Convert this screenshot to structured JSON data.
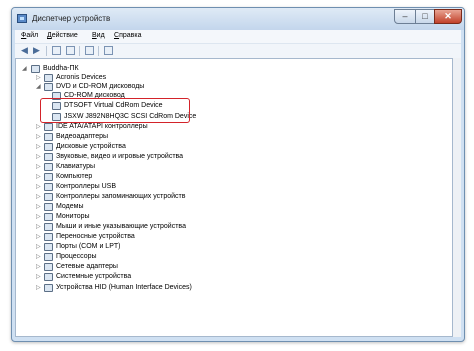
{
  "window": {
    "title": "Диспетчер устройств",
    "controls": {
      "minimize": "–",
      "maximize": "□",
      "close": "✕"
    }
  },
  "menu": [
    {
      "label": "Файл",
      "underline": "Ф",
      "rest": "айл"
    },
    {
      "label": "Действие",
      "underline": "Д",
      "rest": "ействие"
    },
    {
      "label": "Вид",
      "underline": "В",
      "rest": "ид"
    },
    {
      "label": "Справка",
      "underline": "С",
      "rest": "правка"
    }
  ],
  "toolbar": {
    "icons": [
      "back-arrow-icon",
      "forward-arrow-icon",
      "properties-icon",
      "help-icon",
      "device-list-icon",
      "scan-hardware-icon"
    ]
  },
  "tree": {
    "root": "Buddha-ПК",
    "items": [
      {
        "label": "Acronis Devices",
        "expander": "▷"
      },
      {
        "label": "DVD и CD-ROM дисководы",
        "expander": "◢",
        "children": [
          "CD-ROM дисковод",
          "DTSOFT Virtual CdRom Device",
          "JSXW J892N8HQ3C SCSI CdRom Device"
        ]
      },
      {
        "label": "IDE ATA/ATAPI контроллеры",
        "expander": "▷"
      },
      {
        "label": "Видеоадаптеры",
        "expander": "▷"
      },
      {
        "label": "Дисковые устройства",
        "expander": "▷"
      },
      {
        "label": "Звуковые, видео и игровые устройства",
        "expander": "▷"
      },
      {
        "label": "Клавиатуры",
        "expander": "▷"
      },
      {
        "label": "Компьютер",
        "expander": "▷"
      },
      {
        "label": "Контроллеры USB",
        "expander": "▷"
      },
      {
        "label": "Контроллеры запоминающих устройств",
        "expander": "▷"
      },
      {
        "label": "Модемы",
        "expander": "▷"
      },
      {
        "label": "Мониторы",
        "expander": "▷"
      },
      {
        "label": "Мыши и иные указывающие устройства",
        "expander": "▷"
      },
      {
        "label": "Переносные устройства",
        "expander": "▷"
      },
      {
        "label": "Порты (COM и LPT)",
        "expander": "▷"
      },
      {
        "label": "Процессоры",
        "expander": "▷"
      },
      {
        "label": "Сетевые адаптеры",
        "expander": "▷"
      },
      {
        "label": "Системные устройства",
        "expander": "▷"
      },
      {
        "label": "Устройства HID (Human Interface Devices)",
        "expander": "▷"
      }
    ]
  },
  "colors": {
    "highlight": "#d3232a",
    "frame": "#cfe0f2",
    "close_button": "#c1402a"
  }
}
